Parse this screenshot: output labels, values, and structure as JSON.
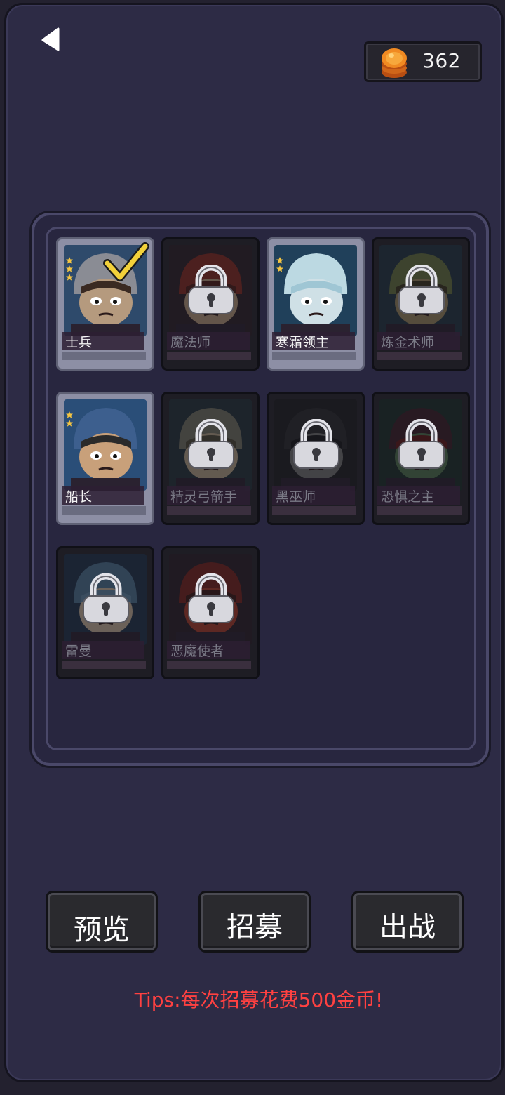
{
  "coins": {
    "value": "362",
    "icon": "gold-coin-stack-icon"
  },
  "back": {
    "icon": "back-arrow-icon"
  },
  "heroes": [
    {
      "name": "士兵",
      "locked": false,
      "selected": true,
      "stars": 3,
      "theme": "soldier"
    },
    {
      "name": "魔法师",
      "locked": true,
      "selected": false,
      "stars": 0,
      "theme": "mage"
    },
    {
      "name": "寒霜领主",
      "locked": false,
      "selected": false,
      "stars": 2,
      "theme": "frost"
    },
    {
      "name": "炼金术师",
      "locked": true,
      "selected": false,
      "stars": 0,
      "theme": "alchemist"
    },
    {
      "name": "船长",
      "locked": false,
      "selected": false,
      "stars": 2,
      "theme": "captain"
    },
    {
      "name": "精灵弓箭手",
      "locked": true,
      "selected": false,
      "stars": 0,
      "theme": "archer"
    },
    {
      "name": "黑巫师",
      "locked": true,
      "selected": false,
      "stars": 0,
      "theme": "warlock"
    },
    {
      "name": "恐惧之主",
      "locked": true,
      "selected": false,
      "stars": 0,
      "theme": "dread"
    },
    {
      "name": "雷曼",
      "locked": true,
      "selected": false,
      "stars": 0,
      "theme": "rayman"
    },
    {
      "name": "恶魔使者",
      "locked": true,
      "selected": false,
      "stars": 0,
      "theme": "demon"
    }
  ],
  "buttons": {
    "preview": "预览",
    "recruit": "招募",
    "battle": "出战"
  },
  "tips": "Tips:每次招募花费500金币!",
  "colors": {
    "background": "#2d2b45",
    "tips": "#ff4141",
    "check": "#f2d13a",
    "star": "#f5c542"
  }
}
